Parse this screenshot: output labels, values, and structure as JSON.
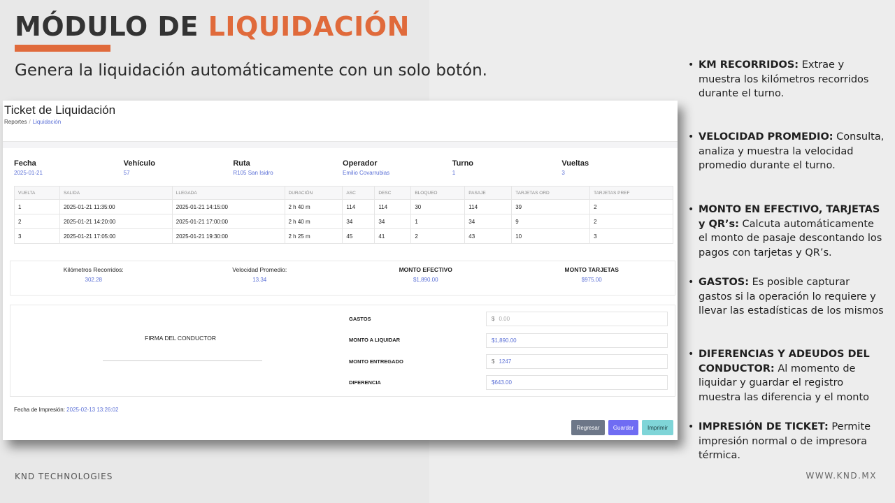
{
  "slide": {
    "title_part1": "MÓDULO DE ",
    "title_part2": "LIQUIDACIÓN",
    "subtitle": "Genera la liquidación automáticamente con un solo botón.",
    "footer_left": "KND TECHNOLOGIES",
    "footer_right": "WWW.KND.MX",
    "accent_color": "#e06a3b"
  },
  "ticket": {
    "title": "Ticket de Liquidación",
    "breadcrumb": [
      "Reportes",
      "Liquidación"
    ],
    "summary": [
      {
        "label": "Fecha",
        "value": "2025-01-21"
      },
      {
        "label": "Vehículo",
        "value": "57"
      },
      {
        "label": "Ruta",
        "value": "R105 San Isidro"
      },
      {
        "label": "Operador",
        "value": "Emilio Covarrubias"
      },
      {
        "label": "Turno",
        "value": "1"
      },
      {
        "label": "Vueltas",
        "value": "3"
      }
    ],
    "table": {
      "headers": [
        "VUELTA",
        "SALIDA",
        "LLEGADA",
        "DURACIÓN",
        "ASC",
        "DESC",
        "BLOQUEO",
        "PASAJE",
        "TARJETAS ORD",
        "TARJETAS PREF"
      ],
      "rows": [
        [
          "1",
          "2025-01-21 11:35:00",
          "2025-01-21 14:15:00",
          "2 h 40 m",
          "114",
          "114",
          "30",
          "114",
          "39",
          "2"
        ],
        [
          "2",
          "2025-01-21 14:20:00",
          "2025-01-21 17:00:00",
          "2 h 40 m",
          "34",
          "34",
          "1",
          "34",
          "9",
          "2"
        ],
        [
          "3",
          "2025-01-21 17:05:00",
          "2025-01-21 19:30:00",
          "2 h 25 m",
          "45",
          "41",
          "2",
          "43",
          "10",
          "3"
        ]
      ]
    },
    "stats": [
      {
        "label": "Kilómetros Recorridos:",
        "value": "302.28"
      },
      {
        "label": "Velocidad Promedio:",
        "value": "13.34"
      },
      {
        "label": "MONTO EFECTIVO",
        "value": "$1,890.00"
      },
      {
        "label": "MONTO TARJETAS",
        "value": "$975.00"
      }
    ],
    "signature_label": "FIRMA DEL CONDUCTOR",
    "form": {
      "gastos_label": "GASTOS",
      "gastos_currency": "$",
      "gastos_placeholder": "0.00",
      "monto_liquidar_label": "MONTO A LIQUIDAR",
      "monto_liquidar_value": "$1,890.00",
      "monto_entregado_label": "MONTO ENTREGADO",
      "monto_entregado_currency": "$",
      "monto_entregado_value": "1247",
      "diferencia_label": "DIFERENCIA",
      "diferencia_value": "$643.00"
    },
    "print_date_label": "Fecha de Impresión:",
    "print_date_value": "2025-02-13 13:26:02",
    "buttons": {
      "back": "Regresar",
      "save": "Guardar",
      "print": "Imprimir"
    }
  },
  "features": [
    {
      "heading": "KM RECORRIDOS:",
      "text": " Extrae y muestra los kilómetros recorridos durante el turno."
    },
    {
      "heading": "VELOCIDAD PROMEDIO:",
      "text": " Consulta, analiza y muestra la velocidad promedio durante el turno."
    },
    {
      "heading": "MONTO EN EFECTIVO, TARJETAS y QR’s:",
      "text": " Calcuta automáticamente el monto de pasaje descontando los pagos con tarjetas y QR’s."
    },
    {
      "heading": "GASTOS:",
      "text": " Es posible capturar gastos si la operación lo requiere y llevar las estadísticas de los mismos"
    },
    {
      "heading": "DIFERENCIAS Y ADEUDOS DEL CONDUCTOR:",
      "text": " Al momento de liquidar y guardar el registro muestra las diferencia y el monto"
    },
    {
      "heading": "IMPRESIÓN DE TICKET:",
      "text": " Permite impresión normal o de impresora térmica."
    }
  ]
}
